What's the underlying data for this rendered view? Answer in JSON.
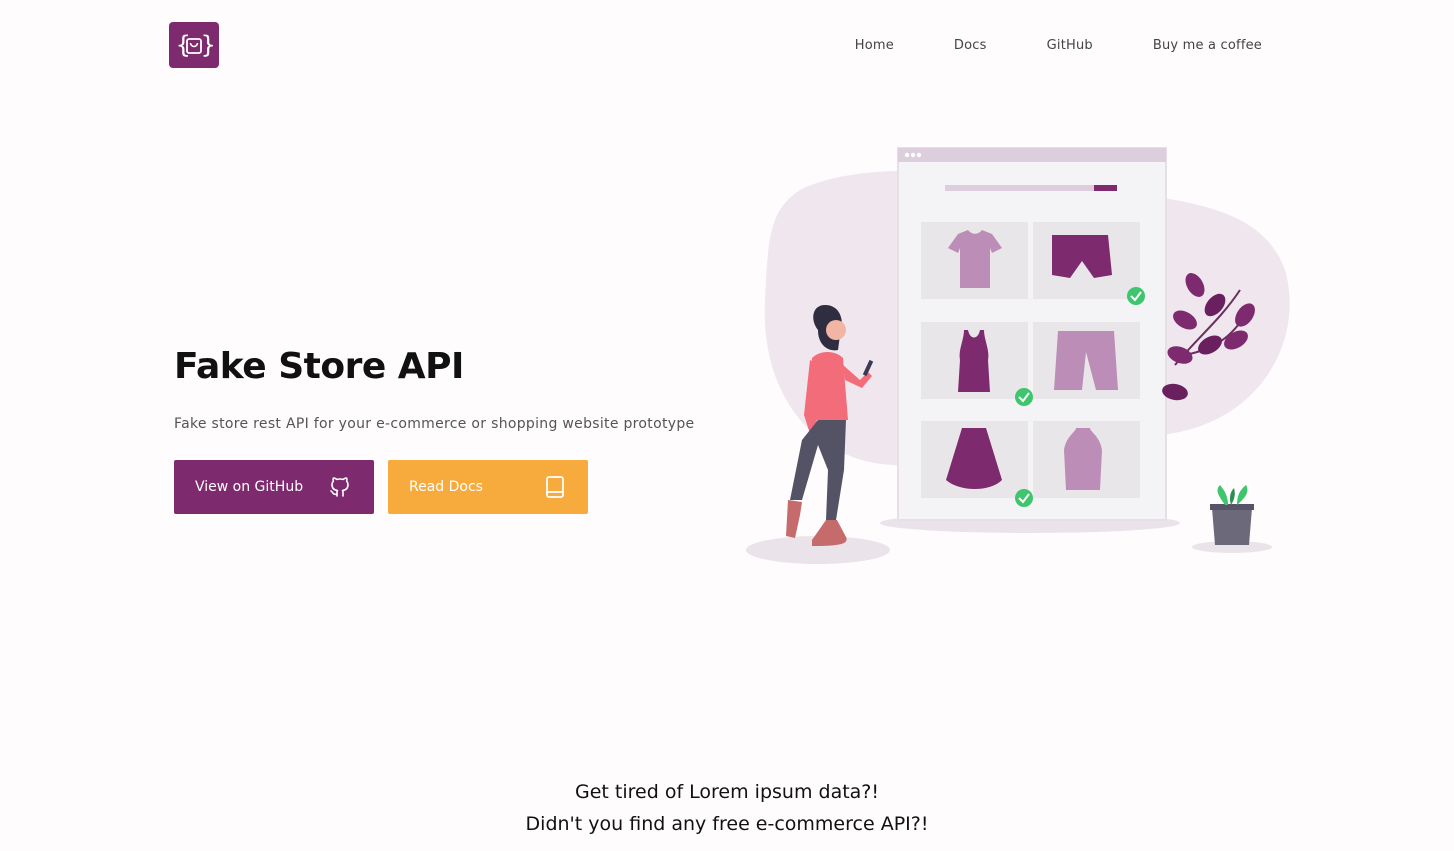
{
  "nav": {
    "home": "Home",
    "docs": "Docs",
    "github": "GitHub",
    "coffee": "Buy me a coffee"
  },
  "hero": {
    "title": "Fake Store API",
    "subtitle": "Fake store rest API for your e-commerce or shopping website prototype",
    "github_button": "View on GitHub",
    "docs_button": "Read Docs"
  },
  "bottom": {
    "line1": "Get tired of Lorem ipsum data?!",
    "line2": "Didn't you find any free e-commerce API?!"
  },
  "colors": {
    "brand": "#7d2a6e",
    "accent": "#f6ab3c",
    "check": "#3fc56e"
  },
  "icons": {
    "logo": "shopping-bag-braces-icon",
    "github": "github-icon",
    "book": "book-icon"
  }
}
